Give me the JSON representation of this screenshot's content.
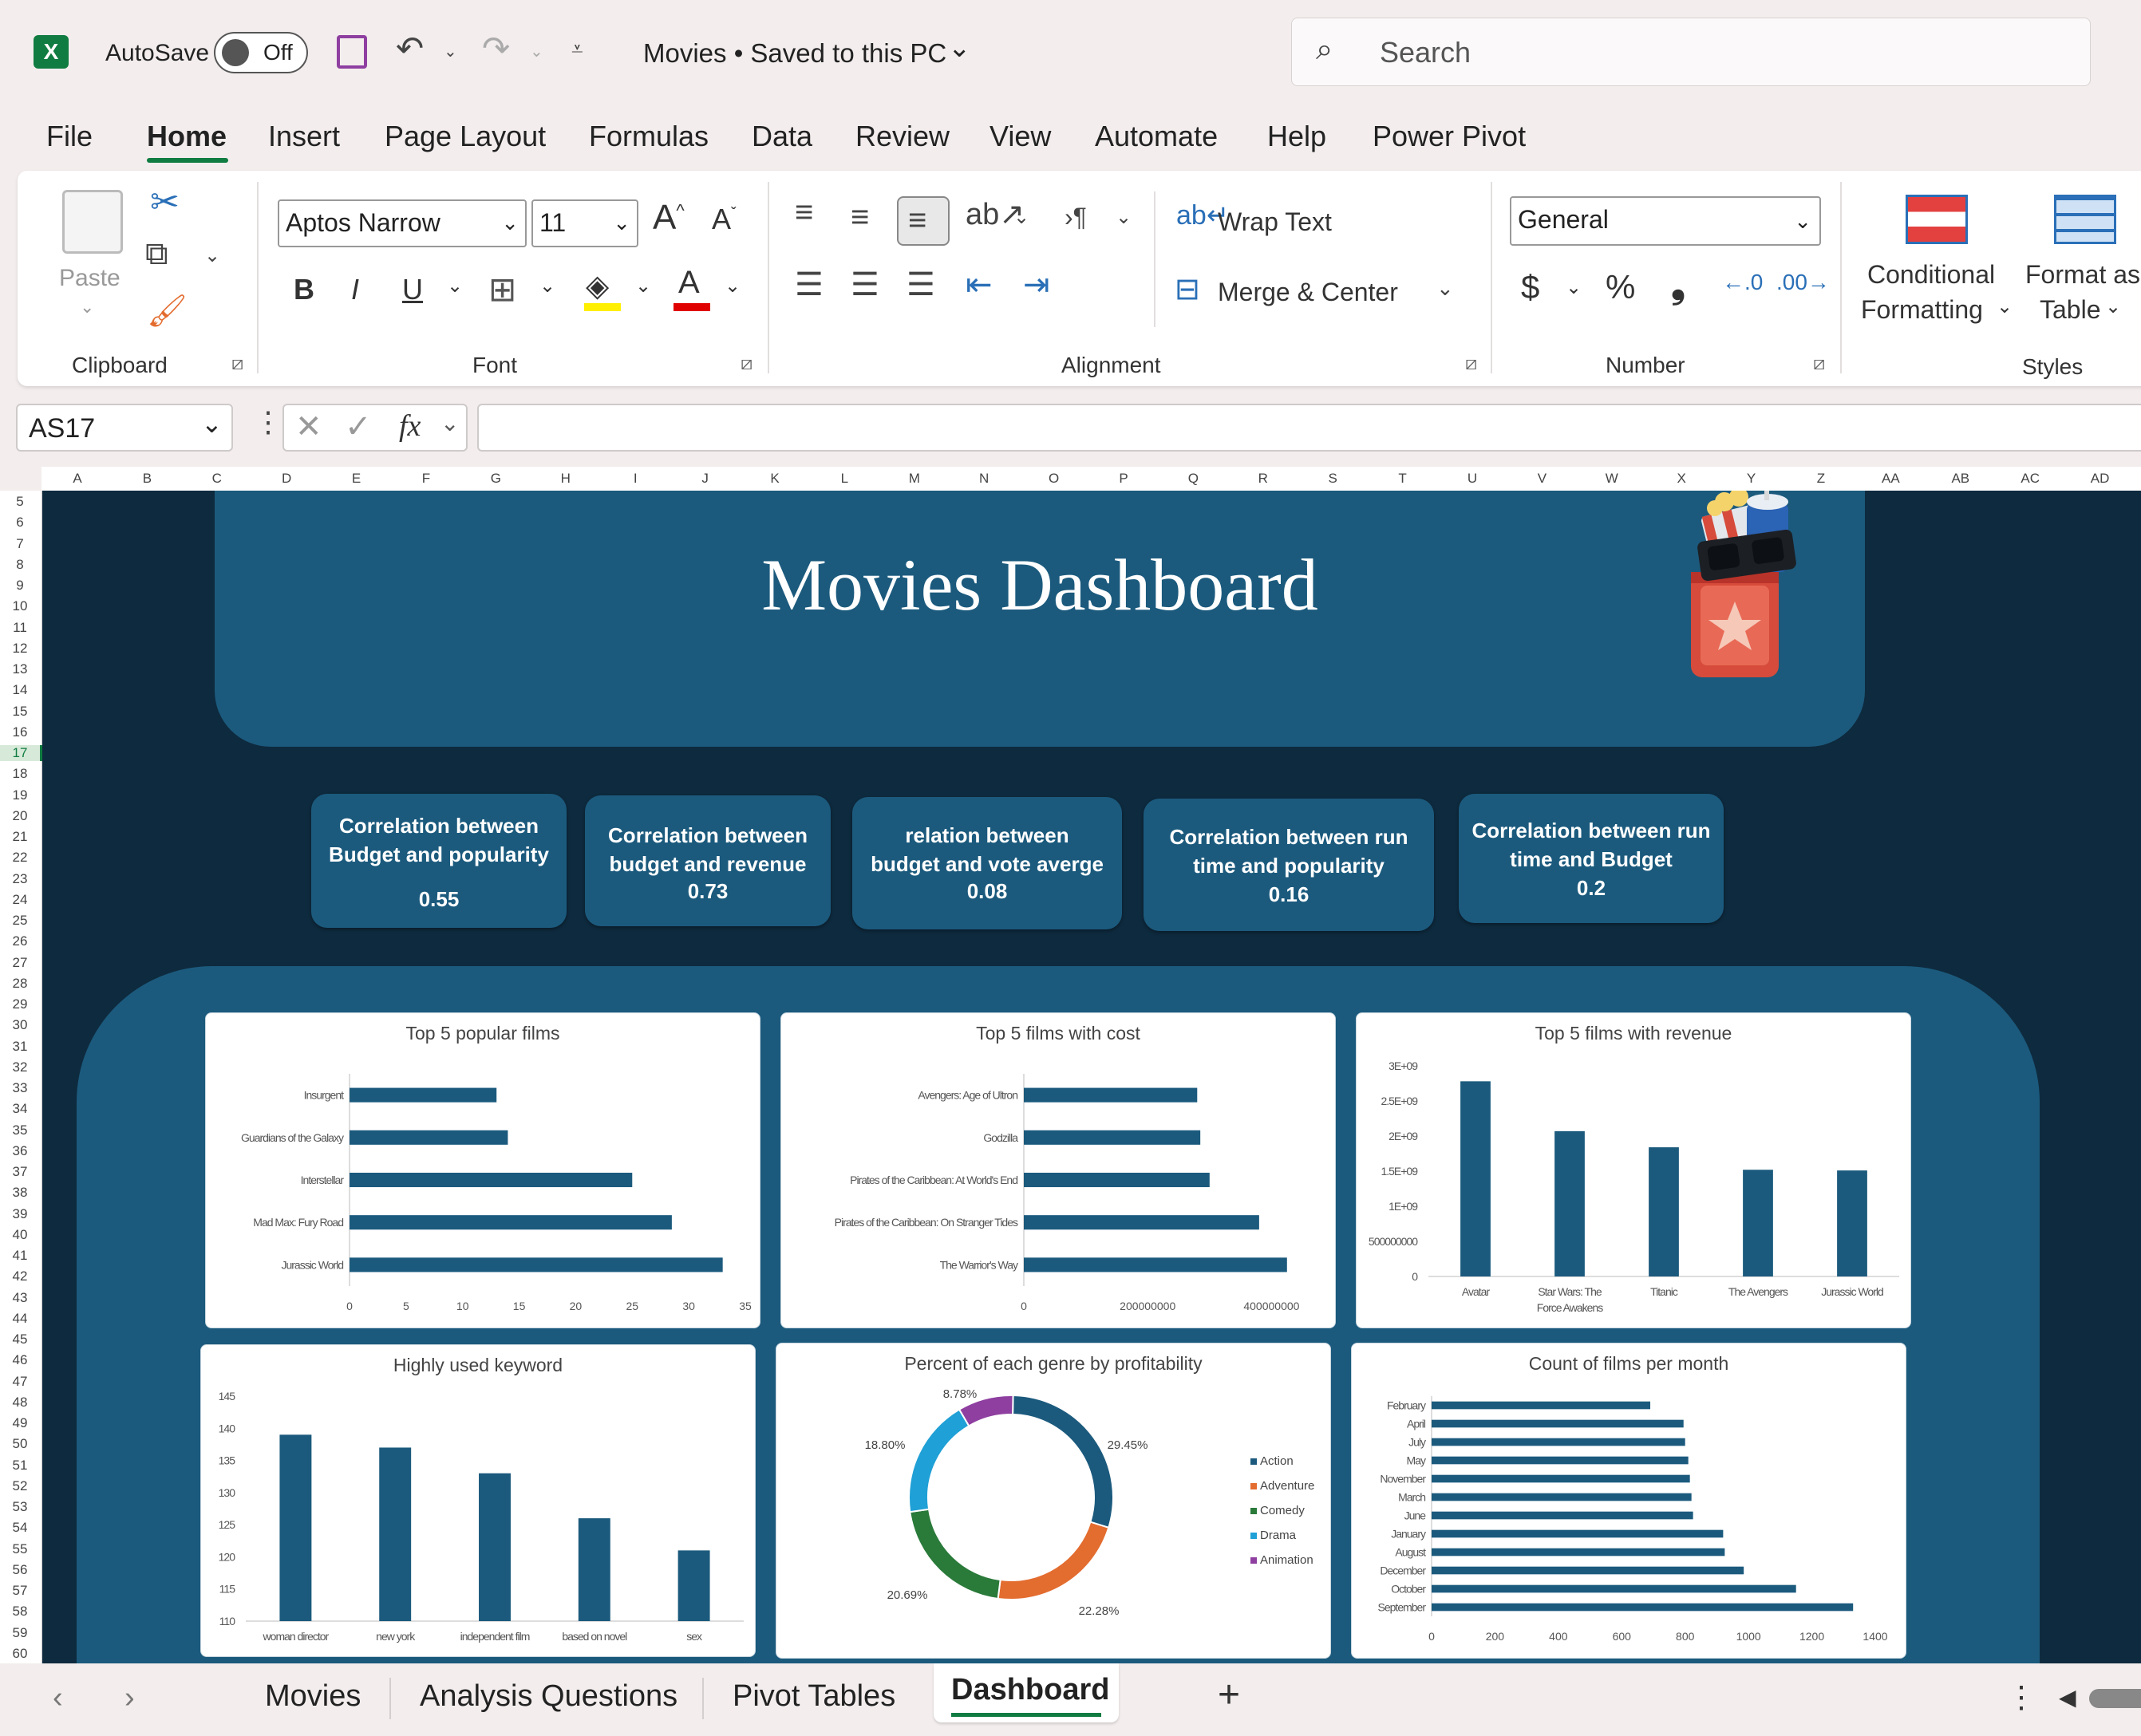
{
  "titlebar": {
    "autosave_label": "AutoSave",
    "autosave_state": "Off",
    "doc_title": "Movies • Saved to this PC",
    "search_placeholder": "Search"
  },
  "menu": [
    "File",
    "Home",
    "Insert",
    "Page Layout",
    "Formulas",
    "Data",
    "Review",
    "View",
    "Automate",
    "Help",
    "Power Pivot"
  ],
  "active_menu": "Home",
  "ribbon": {
    "paste_label": "Paste",
    "font_name": "Aptos Narrow",
    "font_size": "11",
    "wrap_text": "Wrap Text",
    "merge_center": "Merge & Center",
    "number_format": "General",
    "conditional_formatting": [
      "Conditional",
      "Formatting"
    ],
    "format_as_table": [
      "Format as",
      "Table"
    ],
    "groups": {
      "clipboard": "Clipboard",
      "font": "Font",
      "alignment": "Alignment",
      "number": "Number",
      "styles": "Styles"
    }
  },
  "formula_bar": {
    "name_box": "AS17",
    "formula": ""
  },
  "columns": [
    "A",
    "B",
    "C",
    "D",
    "E",
    "F",
    "G",
    "H",
    "I",
    "J",
    "K",
    "L",
    "M",
    "N",
    "O",
    "P",
    "Q",
    "R",
    "S",
    "T",
    "U",
    "V",
    "W",
    "X",
    "Y",
    "Z",
    "AA",
    "AB",
    "AC",
    "AD"
  ],
  "rows": [
    "5",
    "6",
    "7",
    "8",
    "9",
    "10",
    "11",
    "12",
    "13",
    "14",
    "15",
    "16",
    "17",
    "18",
    "19",
    "20",
    "21",
    "22",
    "23",
    "24",
    "25",
    "26",
    "27",
    "28",
    "29",
    "30",
    "31",
    "32",
    "33",
    "34",
    "35",
    "36",
    "37",
    "38",
    "39",
    "40",
    "41",
    "42",
    "43",
    "44",
    "45",
    "46",
    "47",
    "48",
    "49",
    "50",
    "51",
    "52",
    "53",
    "54",
    "55",
    "56",
    "57",
    "58",
    "59",
    "60"
  ],
  "dashboard": {
    "title": "Movies Dashboard",
    "kpis": [
      {
        "title": "Correlation between Budget and popularity",
        "value": "0.55"
      },
      {
        "title": "Correlation between budget and revenue",
        "value": "0.73"
      },
      {
        "title": "relation between budget and vote averge",
        "value": "0.08"
      },
      {
        "title": "Correlation between run time and popularity",
        "value": "0.16"
      },
      {
        "title": "Correlation between run time and Budget",
        "value": "0.2"
      }
    ]
  },
  "chart_data": [
    {
      "type": "bar",
      "orientation": "horizontal",
      "title": "Top 5 popular films",
      "categories": [
        "Insurgent",
        "Guardians of the Galaxy",
        "Interstellar",
        "Mad Max: Fury Road",
        "Jurassic World"
      ],
      "values": [
        13,
        14,
        25,
        28.5,
        33
      ],
      "xticks": [
        "0",
        "5",
        "10",
        "15",
        "20",
        "25",
        "30",
        "35"
      ],
      "xlim": [
        0,
        35
      ]
    },
    {
      "type": "bar",
      "orientation": "horizontal",
      "title": "Top 5 films with cost",
      "categories": [
        "Avengers: Age of Ultron",
        "Godzilla",
        "Pirates of the Caribbean: At World's End",
        "Pirates of the Caribbean: On Stranger Tides",
        "The Warrior's Way"
      ],
      "values": [
        280000000,
        285000000,
        300000000,
        380000000,
        425000000
      ],
      "xticks": [
        "0",
        "200000000",
        "400000000"
      ],
      "xlim": [
        0,
        500000000
      ]
    },
    {
      "type": "bar",
      "orientation": "vertical",
      "title": "Top 5 films with revenue",
      "categories": [
        "Avatar",
        "Star Wars: The Force Awakens",
        "Titanic",
        "The Avengers",
        "Jurassic World"
      ],
      "values": [
        2780000000,
        2070000000,
        1840000000,
        1520000000,
        1510000000
      ],
      "yticks": [
        "0",
        "500000000",
        "1E+09",
        "1.5E+09",
        "2E+09",
        "2.5E+09",
        "3E+09"
      ],
      "ylim": [
        0,
        3000000000
      ]
    },
    {
      "type": "bar",
      "orientation": "vertical",
      "title": "Highly used keyword",
      "categories": [
        "woman director",
        "new york",
        "independent film",
        "based on novel",
        "sex"
      ],
      "values": [
        139,
        137,
        133,
        126,
        121
      ],
      "yticks": [
        "110",
        "115",
        "120",
        "125",
        "130",
        "135",
        "140",
        "145"
      ],
      "ylim": [
        110,
        145
      ]
    },
    {
      "type": "pie",
      "donut": true,
      "title": "Percent of each genre by profitability",
      "labels": [
        "Action",
        "Adventure",
        "Comedy",
        "Drama",
        "Animation"
      ],
      "values": [
        29.45,
        22.28,
        20.69,
        18.8,
        8.78
      ],
      "value_labels": [
        "29.45%",
        "22.28%",
        "20.69%",
        "18.80%",
        "8.78%"
      ],
      "colors": [
        "#1b5a7d",
        "#e36c2f",
        "#2a7a3a",
        "#1fa0d6",
        "#8e3fa0"
      ],
      "legend": "right"
    },
    {
      "type": "bar",
      "orientation": "horizontal",
      "title": "Count of films per month",
      "categories": [
        "February",
        "April",
        "July",
        "May",
        "November",
        "March",
        "June",
        "January",
        "August",
        "December",
        "October",
        "September"
      ],
      "values": [
        690,
        795,
        800,
        810,
        815,
        820,
        825,
        920,
        925,
        985,
        1150,
        1330
      ],
      "xticks": [
        "0",
        "200",
        "400",
        "600",
        "800",
        "1000",
        "1200",
        "1400"
      ],
      "xlim": [
        0,
        1400
      ]
    }
  ],
  "sheet_tabs": [
    "Movies",
    "Analysis Questions",
    "Pivot Tables",
    "Dashboard"
  ],
  "active_tab": "Dashboard",
  "colors": {
    "bar": "#1b5a7d",
    "sheet_bg": "#0e2a3e",
    "panel": "#1b5a7d",
    "accent_green": "#107c41"
  }
}
